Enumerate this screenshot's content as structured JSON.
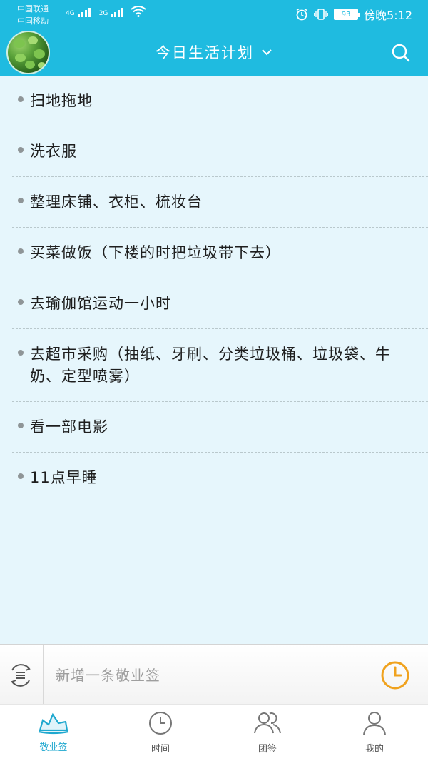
{
  "status_bar": {
    "carrier_1": "中国联通",
    "carrier_2": "中国移动",
    "network_1": "4G",
    "network_2": "2G",
    "battery": "93",
    "time": "傍晚5:12"
  },
  "header": {
    "title": "今日生活计划"
  },
  "tasks": [
    "扫地拖地",
    "洗衣服",
    "整理床铺、衣柜、梳妆台",
    "买菜做饭（下楼的时把垃圾带下去）",
    "去瑜伽馆运动一小时",
    "去超市采购（抽纸、牙刷、分类垃圾桶、垃圾袋、牛奶、定型喷雾）",
    "看一部电影",
    "11点早睡"
  ],
  "input": {
    "placeholder": "新增一条敬业签",
    "value": ""
  },
  "nav": [
    {
      "label": "敬业签",
      "icon": "boat-icon",
      "active": true
    },
    {
      "label": "时间",
      "icon": "clock-icon",
      "active": false
    },
    {
      "label": "团签",
      "icon": "group-icon",
      "active": false
    },
    {
      "label": "我的",
      "icon": "person-icon",
      "active": false
    }
  ],
  "colors": {
    "accent": "#1fbbe0",
    "background": "#e6f6fc",
    "clock_orange": "#f0a21e",
    "nav_active": "#1fa8cf"
  }
}
